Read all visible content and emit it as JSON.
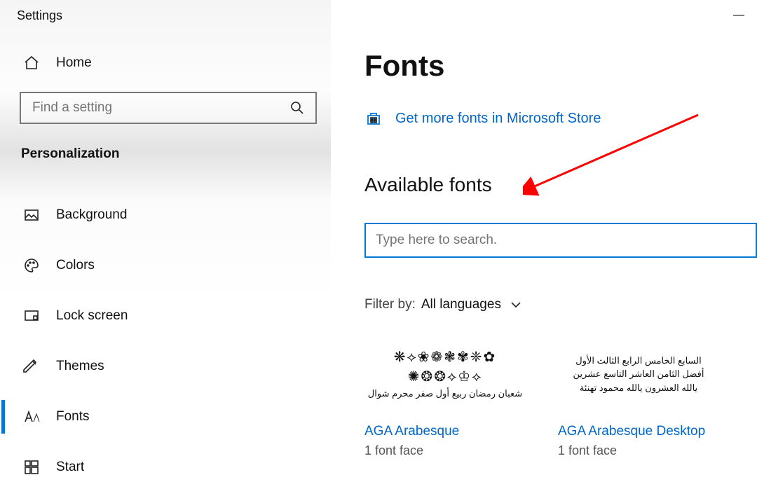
{
  "window": {
    "title": "Settings"
  },
  "sidebar": {
    "home": "Home",
    "search_placeholder": "Find a setting",
    "section": "Personalization",
    "items": [
      {
        "label": "Background"
      },
      {
        "label": "Colors"
      },
      {
        "label": "Lock screen"
      },
      {
        "label": "Themes"
      },
      {
        "label": "Fonts",
        "active": true
      },
      {
        "label": "Start"
      }
    ]
  },
  "main": {
    "title": "Fonts",
    "store_link": "Get more fonts in Microsoft Store",
    "subheading": "Available fonts",
    "search_placeholder": "Type here to search.",
    "filter_label": "Filter by:",
    "filter_value": "All languages",
    "cards": [
      {
        "name": "AGA Arabesque",
        "faces": "1 font face",
        "preview_deco": "❋⟡❀❁❃✾❈✿",
        "preview_deco2": "✺❂❂⟡♔⟡",
        "preview_ar": "شعبان رمضان ربيع أول صفر محرم شوال"
      },
      {
        "name": "AGA Arabesque Desktop",
        "faces": "1 font face",
        "preview_ar1": "السابع الخامس الرابع الثالث الأول",
        "preview_ar2": "أفضل الثامن العاشر التاسع عشرين",
        "preview_ar3": "يالله العشرون يالله محمود تهنئة"
      }
    ]
  }
}
